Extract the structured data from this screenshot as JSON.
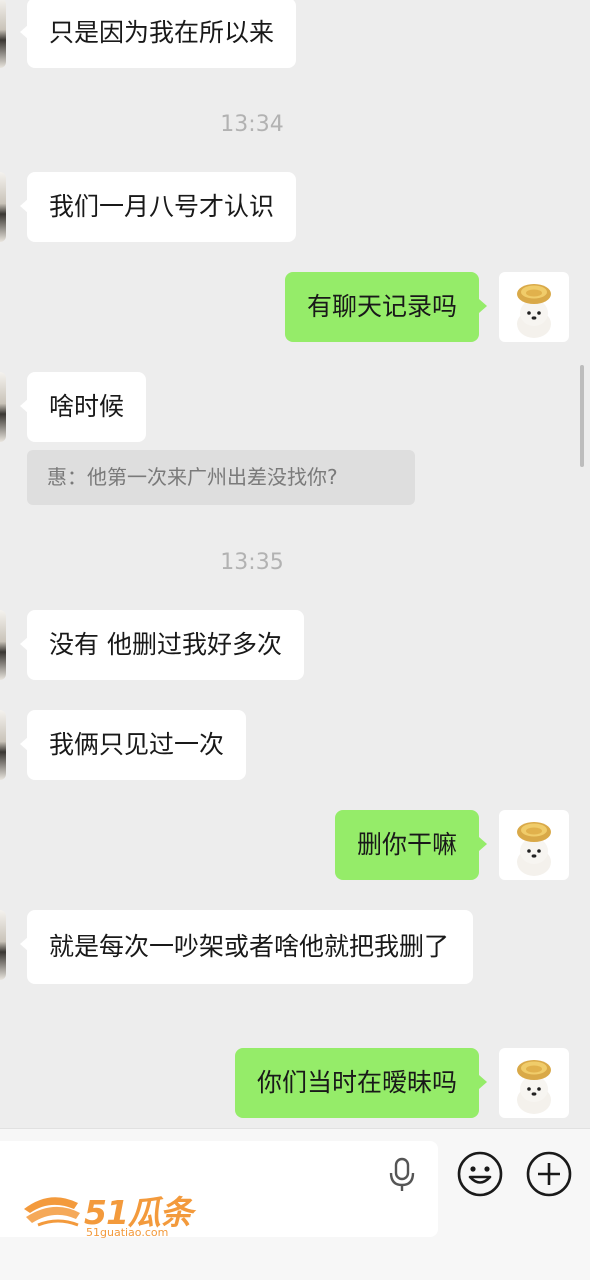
{
  "messages": [
    {
      "side": "left",
      "text": "只是因为我在所以来"
    },
    {
      "time": "13:34"
    },
    {
      "side": "left",
      "text": "我们一月八号才认识"
    },
    {
      "side": "right",
      "text": "有聊天记录吗"
    },
    {
      "side": "left",
      "text": "啥时候"
    },
    {
      "quote": "惠：他第一次来广州出差没找你?"
    },
    {
      "time": "13:35"
    },
    {
      "side": "left",
      "text": "没有 他删过我好多次"
    },
    {
      "side": "left",
      "text": "我俩只见过一次"
    },
    {
      "side": "right",
      "text": "删你干嘛"
    },
    {
      "side": "left",
      "text": "就是每次一吵架或者啥他就把我删了"
    },
    {
      "side": "right",
      "text": "你们当时在暧昧吗"
    }
  ],
  "input_bar": {
    "placeholder": "",
    "icons": [
      "microphone-icon",
      "emoji-icon",
      "plus-icon"
    ]
  },
  "watermark": {
    "brand": "51瓜条",
    "url": "51guatiao.com"
  },
  "colors": {
    "background": "#ededed",
    "incoming_bubble": "#ffffff",
    "outgoing_bubble": "#95ec69",
    "timestamp": "#b2b2b2",
    "watermark": "#f39a3c"
  }
}
